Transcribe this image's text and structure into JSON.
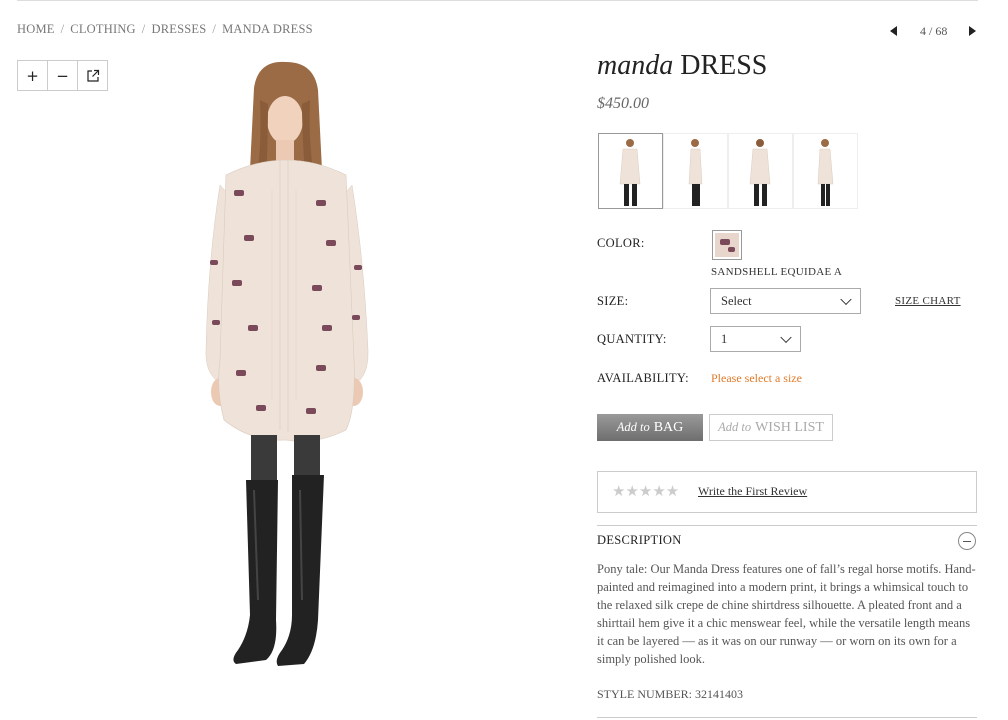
{
  "breadcrumb": {
    "items": [
      "HOME",
      "CLOTHING",
      "DRESSES",
      "MANDA DRESS"
    ],
    "separator": "/"
  },
  "pager": {
    "count": "4 / 68"
  },
  "zoom": {
    "in": "+",
    "out": "−"
  },
  "product": {
    "name_italic": "manda",
    "name_caps": "DRESS",
    "price": "$450.00"
  },
  "thumbnails": {
    "count": 4,
    "active_index": 0
  },
  "options": {
    "color_label": "COLOR:",
    "color_name": "SANDSHELL EQUIDAE A",
    "size_label": "SIZE:",
    "size_value": "Select",
    "size_chart": "SIZE CHART",
    "quantity_label": "QUANTITY:",
    "quantity_value": "1",
    "availability_label": "AVAILABILITY:",
    "availability_value": "Please select a size"
  },
  "actions": {
    "bag_italic": "Add to",
    "bag_caps": "BAG",
    "wish_italic": "Add to",
    "wish_caps": "WISH LIST"
  },
  "reviews": {
    "stars_empty": "★★★★★",
    "rating": 0,
    "write_link": "Write the First Review"
  },
  "description": {
    "heading": "DESCRIPTION",
    "body": "Pony tale: Our Manda Dress features one of fall’s regal horse motifs. Hand-painted and reimagined into a modern print, it brings a whimsical touch to the relaxed silk crepe de chine shirtdress silhouette. A pleated front and a shirttail hem give it a chic menswear feel, while the versatile length means it can be layered — as it was on our runway — or worn on its own for a simply polished look.",
    "style_number": "STYLE NUMBER: 32141403"
  },
  "colors": {
    "accent_orange": "#e07b2a",
    "dress": "#efe3d9",
    "boots": "#222222"
  }
}
